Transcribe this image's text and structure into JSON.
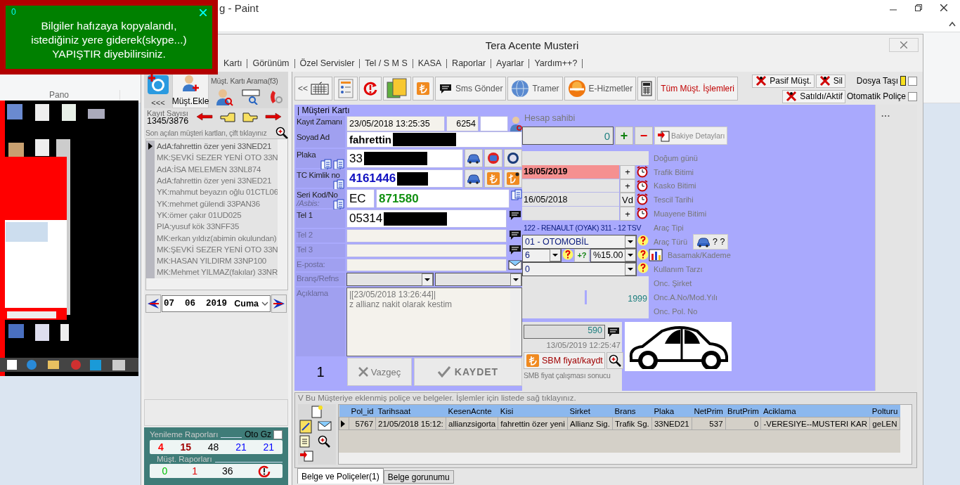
{
  "paint": {
    "title": "g - Paint",
    "ribbon_group": "Pano"
  },
  "toast": {
    "counter": "0",
    "lines": [
      "Bilgiler hafızaya kopyalandı,",
      "istediğiniz yere giderek(skype...)",
      "YAPIŞTIR diyebilirsiniz."
    ]
  },
  "window": {
    "title": "Tera Acente Musteri"
  },
  "menu": [
    "Kartı",
    "Görünüm",
    "Özel Servisler",
    "Tel / S M S",
    "KASA",
    "Raporlar",
    "Ayarlar",
    "Yardım++?"
  ],
  "sidebar": {
    "collapse": "<<<",
    "add_customer": "Müşt.Ekle",
    "search_label": "Müşt. Kartı Arama(f3)",
    "count_label": "Kayıt Sayısı",
    "count": "1345/3876",
    "recent_label": "Son açılan müşteri kartları, çift tıklayınız",
    "recent": [
      {
        "text": "AdA:fahrettin özer yeni 33NED21",
        "selected": true
      },
      {
        "text": "MK:ŞEVKİ SEZER YENİ OTO 33N",
        "selected": false
      },
      {
        "text": "AdA:İSA MELEMEN 33NL874",
        "selected": false
      },
      {
        "text": "AdA:fahrettin özer yeni 33NED21",
        "selected": false
      },
      {
        "text": "YK:mahmut beyazın oğlu 01CTL06",
        "selected": false
      },
      {
        "text": "YK:mehmet gülendi 33PAN36",
        "selected": false
      },
      {
        "text": "YK:ömer çakır 01UD025",
        "selected": false
      },
      {
        "text": "PIA:yusuf kök 33NFF35",
        "selected": false
      },
      {
        "text": "MK:erkan yıldız(abimin okulundan)",
        "selected": false
      },
      {
        "text": "MK:ŞEVKİ SEZER YENİ OTO 33N",
        "selected": false
      },
      {
        "text": "MK:HASAN YILDIRM 33NP100",
        "selected": false
      },
      {
        "text": "MK:Mehmet YILMAZ(fakılar) 33NR",
        "selected": false
      }
    ],
    "date": {
      "value": "07  06  2019",
      "weekday": "Cuma"
    },
    "reports": {
      "renewal_label": "Yenileme Raporları",
      "auto": {
        "label": "Oto Gz",
        "checked": false
      },
      "renewal": [
        {
          "text": "4",
          "color": "#ff0000"
        },
        {
          "text": "15",
          "color": "#a00000"
        },
        {
          "text": "48",
          "color": "#000000"
        },
        {
          "text": "21",
          "color": "#0000ff"
        },
        {
          "text": "21",
          "color": "#0000ff"
        }
      ],
      "customer_label": "Müşt. Raporları",
      "customer": [
        {
          "text": "0",
          "color": "#00c000"
        },
        {
          "text": "1",
          "color": "#e00000"
        },
        {
          "text": "36",
          "color": "#000000"
        }
      ]
    }
  },
  "toolbar": {
    "buttons": [
      {
        "kind": "keyboard",
        "label": "<<"
      },
      {
        "kind": "card"
      },
      {
        "kind": "alert"
      },
      {
        "kind": "copy"
      },
      {
        "kind": "lira"
      },
      {
        "kind": "sms",
        "label": "Sms Gönder"
      },
      {
        "kind": "globe",
        "label": "Tramer"
      },
      {
        "kind": "www",
        "label": "E-Hizmetler"
      },
      {
        "kind": "calculator"
      },
      {
        "kind": "text",
        "label": "Tüm Müşt. İşlemleri"
      }
    ],
    "actions": [
      "Pasif Müşt.",
      "Sil",
      "Satıldı/Aktif"
    ],
    "options": [
      {
        "label": "Dosya Taşı",
        "checked": false
      },
      {
        "label": "Otomatik Poliçe",
        "checked": false
      }
    ]
  },
  "form": {
    "title": "| Müşteri Kartı",
    "rows": [
      {
        "kind": "stamp",
        "label": "Kayıt Zamanı",
        "value": "23/05/2018 13:25:35",
        "number": "6254",
        "disabled": false
      },
      {
        "kind": "name",
        "label": "Soyad Ad",
        "value": "fahrettin",
        "disabled": false
      },
      {
        "kind": "plate",
        "label": "Plaka",
        "value": "33",
        "disabled": false
      },
      {
        "kind": "id",
        "label": "TC Kimlik no",
        "value": "4161446",
        "disabled": false
      },
      {
        "kind": "serial",
        "label": "Seri Kod/No",
        "sublabel": "/Asbis:",
        "code": "EC",
        "value": "871580",
        "disabled": false
      },
      {
        "kind": "phone",
        "label": "Tel 1",
        "value": "05314",
        "disabled": false
      },
      {
        "kind": "phone",
        "label": "Tel 2",
        "disabled": true
      },
      {
        "kind": "phone",
        "label": "Tel 3",
        "disabled": true
      },
      {
        "kind": "email",
        "label": "E-posta:",
        "disabled": true
      },
      {
        "kind": "select",
        "label": "Branş/Refns",
        "disabled": true
      },
      {
        "kind": "memo",
        "label": "Açıklama",
        "lines": [
          "|[23/05/2018 13:26:44]|",
          "z allianz nakit olarak kestim"
        ],
        "disabled": true
      }
    ],
    "counter": "1",
    "cancel": "Vazgeç",
    "save": "KAYDET",
    "account": {
      "label": "Hesap sahibi",
      "balance": "0",
      "add": "+",
      "subtract": "−",
      "details": "Bakiye Detayları"
    },
    "details": [
      {
        "kind": "blank",
        "label": "Doğum günü"
      },
      {
        "kind": "date",
        "label": "Trafik Bitimi",
        "value": "18/05/2019",
        "button": "+",
        "highlighted": true
      },
      {
        "kind": "date",
        "label": "Kasko Bitimi",
        "button": "+",
        "highlighted": false
      },
      {
        "kind": "date",
        "label": "Tescil Tarihi",
        "value": "16/05/2018",
        "button": "Vd",
        "highlighted": false
      },
      {
        "kind": "date",
        "label": "Muayene Bitimi",
        "button": "+",
        "highlighted": false
      },
      {
        "kind": "text",
        "label": "Araç Tipi",
        "value": "122 - RENAULT (OYAK) 311 - 12 TSV"
      },
      {
        "kind": "select",
        "label": "Araç Türü",
        "value": "01 - OTOMOBİL",
        "button": "? ?"
      },
      {
        "kind": "tier",
        "label": "Basamak/Kademe",
        "value": "6",
        "extra": "+?",
        "rate": "%15.00"
      },
      {
        "kind": "select",
        "label": "Kullanım Tarzı",
        "value": "0"
      },
      {
        "kind": "blank",
        "label": "Onc. Şirket"
      },
      {
        "kind": "pair",
        "label": "Onc.A.No/Mod.Yılı",
        "value": "1999"
      },
      {
        "kind": "blank",
        "label": "Onc. Pol. No"
      }
    ],
    "price": {
      "value": "590",
      "time": "13/05/2019 12:25:47",
      "button": "SBM fiyat/kaydt",
      "note": "SMB fiyat çalışması sonucu"
    },
    "more": "..."
  },
  "policies": {
    "caption": "V Bu Müşteriye eklenmiş poliçe ve belgeler. İşlemler için listede sağ tıklayınız.",
    "columns": [
      "Pol_id",
      "Tarihsaat",
      "KesenAcnte",
      "Kisi",
      "Sirket",
      "Brans",
      "Plaka",
      "NetPrim",
      "BrutPrim",
      "Aciklama",
      "Polturu"
    ],
    "rows": [
      {
        "selected": true,
        "cells": [
          "5767",
          "21/05/2018 15:12:",
          "allianzsigorta",
          "fahrettin özer yeni",
          "Allianz Sig.",
          "Trafik Sg.",
          "33NED21",
          "537",
          "0",
          "-VERESIYE--MUSTERI KAR",
          "geLEN"
        ]
      }
    ]
  },
  "tabs": [
    {
      "label": "Belge ve Poliçeler(1)",
      "selected": true
    },
    {
      "label": "Belge gorunumu",
      "selected": false
    }
  ]
}
